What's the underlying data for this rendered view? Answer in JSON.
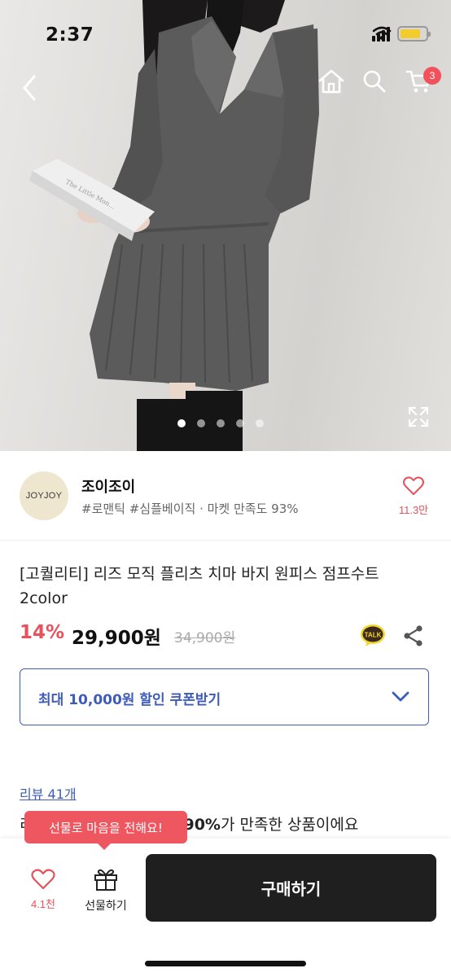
{
  "status_bar": {
    "time": "2:37"
  },
  "product_image": {
    "book_text": "The Little Mon...",
    "pager_count": 5,
    "active_index": 0
  },
  "cart": {
    "badge_count": "3"
  },
  "seller": {
    "logo_text": "JOYJOY",
    "name": "조이조이",
    "tags": "#로맨틱 #심플베이직 · 마켓 만족도 93%",
    "likes": "11.3만"
  },
  "product": {
    "title": "[고퀄리티] 리즈 모직 플리츠 치마 바지 원피스 점프수트 2color",
    "discount": "14%",
    "price": "29,900원",
    "original_price": "34,900원"
  },
  "talk_icon_text": "TALK",
  "coupon": {
    "label": "최대 10,000원 할인 쿠폰받기"
  },
  "reviews": {
    "link": "리뷰 41개",
    "summary_prefix": "리",
    "summary_highlight": "90%",
    "summary_suffix": "가 만족한 상품이에요"
  },
  "bottom_bar": {
    "tooltip": "선물로 마음을 전해요!",
    "wish_count": "4.1천",
    "gift_label": "선물하기",
    "buy_label": "구매하기"
  },
  "colors": {
    "accent_red": "#e8515b",
    "link_blue": "#3d5bb8",
    "buy_button": "#1f1f1f"
  }
}
